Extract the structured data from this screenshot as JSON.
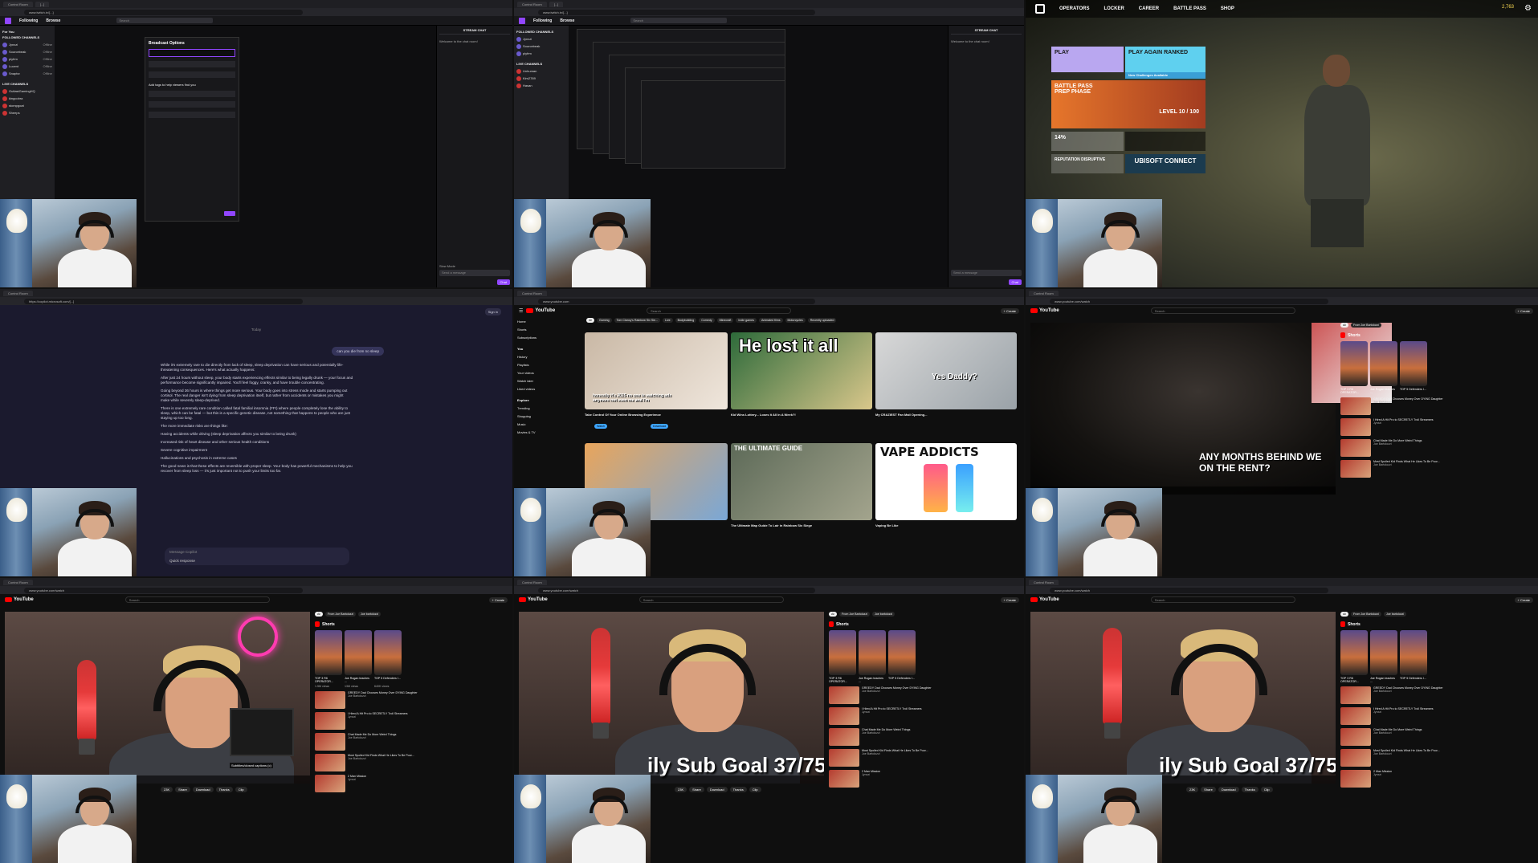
{
  "cells": {
    "c1": {
      "tabs": [
        "Control Room",
        "[...]"
      ],
      "url": "www.twitch.tv/[...]",
      "nav": [
        "For You",
        "Following",
        "Browse"
      ],
      "search_placeholder": "Search",
      "sidebar_header": "FOLLOWED CHANNELS",
      "live_header": "LIVE CHANNELS",
      "channels": [
        {
          "name": "Jynxzi",
          "status": "Offline"
        },
        {
          "name": "Sourcebeak",
          "status": "Offline"
        },
        {
          "name": "plyfrm",
          "status": "Offline"
        },
        {
          "name": "Lucent",
          "status": "Offline"
        },
        {
          "name": "Snaptrz",
          "status": "Offline"
        }
      ],
      "live_channels": [
        "OutlastGamingHQ",
        "kingcobra",
        "stompgoat",
        "Sheeps",
        "Unhuman",
        "Kim2789",
        "Hasan"
      ],
      "modal_title": "Broadcast Options",
      "modal_cta": "Add tags to help viewers find you",
      "chat_header": "STREAM CHAT",
      "chat_welcome": "Welcome to the chat room!",
      "chat_mode": "Slow Mode",
      "chat_placeholder": "Send a message",
      "chat_button": "Chat"
    },
    "c3": {
      "nav": [
        "OPERATORS",
        "LOCKER",
        "CAREER",
        "BATTLE PASS",
        "SHOP"
      ],
      "credits": "2,763",
      "play": "PLAY",
      "ranked": "PLAY AGAIN RANKED",
      "challenges": "New Challenges Available",
      "battlepass": "BATTLE PASS PREP PHASE",
      "level": "LEVEL 10 / 100",
      "reputation": "REPUTATION DISRUPTIVE",
      "connect": "UBISOFT CONNECT",
      "percent": "14%"
    },
    "c4": {
      "url": "https://copilot.microsoft.com/[...]",
      "signin": "Sign in",
      "today": "Today",
      "question": "can you die from no sleep",
      "answer": [
        "While it's extremely rare to die directly from lack of sleep, sleep deprivation can have serious and potentially life-threatening consequences. Here's what actually happens:",
        "After just 24 hours without sleep, your body starts experiencing effects similar to being legally drunk — your focus and performance become significantly impaired. You'll feel foggy, cranky, and have trouble concentrating.",
        "Going beyond 36 hours is where things get more serious. Your body goes into stress mode and starts pumping out cortisol. The real danger isn't dying from sleep deprivation itself, but rather from accidents or mistakes you might make while severely sleep-deprived.",
        "There is one extremely rare condition called fatal familial insomnia (FFI) where people completely lose the ability to sleep, which can be fatal — but this is a specific genetic disease, not something that happens to people who are just staying up too long.",
        "The more immediate risks are things like:",
        "Having accidents while driving (sleep deprivation affects you similar to being drunk)",
        "Increased risk of heart disease and other serious health conditions",
        "Severe cognitive impairment",
        "Hallucinations and psychosis in extreme cases",
        "The good news is that these effects are reversible with proper sleep. Your body has powerful mechanisms to help you recover from sleep loss — it's just important not to push your limits too far."
      ],
      "input_placeholder": "Message Copilot",
      "quick_response": "Quick response"
    },
    "c5": {
      "search": "Search",
      "create": "+ Create",
      "chips": [
        "All",
        "Gaming",
        "Tom Clancy's Rainbow Six Sie...",
        "Live",
        "Bodybuilding",
        "Comedy",
        "Minecraft",
        "Indie games",
        "Animated films",
        "Motorcycles",
        "Recently uploaded",
        "Watched",
        "New to you"
      ],
      "side": [
        "Home",
        "Shorts",
        "Subscriptions",
        "You",
        "History",
        "Playlists",
        "Your videos",
        "Watch later",
        "Liked videos",
        "Explore",
        "Trending",
        "Shopping",
        "Music",
        "Movies & TV"
      ],
      "videos": [
        {
          "title": "Take Control Of Your Online Browsing Experience",
          "overlay": "honestly it's 2025 no one is watching ads anymore not even me and I'm"
        },
        {
          "title": "Kid Wins Lottery... Loses It All In A Week?!",
          "overlay": "He lost it all"
        },
        {
          "title": "My CRAZIEST Fan Mail Opening...",
          "overlay": "Yes Daddy?"
        },
        {
          "title": "",
          "overlay": ""
        },
        {
          "title": "The Ultimate Map Guide To Lair in Rainbow Six Siege",
          "overlay": "THE ULTIMATE GUIDE"
        },
        {
          "title": "Vaping Be Like",
          "overlay": "VAPE ADDICTS"
        }
      ],
      "watch": "Watch",
      "download": "Download"
    },
    "c6": {
      "caption": "ANY MONTHS BEHIND WE ON THE RENT?",
      "subgoal": "ily Sub Goal 37/75"
    },
    "watch": {
      "chips": [
        "All",
        "From Joe Bartolozzi",
        "Joe bartolozzi"
      ],
      "shorts_header": "Shorts",
      "shorts": [
        {
          "title": "TOP 3 R6 OPERATOR...",
          "views": "1.5M views"
        },
        {
          "title": "Joe Rogan teaches ...",
          "views": "13M views"
        },
        {
          "title": "TOP 5 Defenders I...",
          "views": "640K views"
        }
      ],
      "recs": [
        {
          "title": "GREEDY Dad Chooses Money Over DYING Daughter",
          "channel": "Joe Bartolozzi"
        },
        {
          "title": "I Hired A Hit Pro to SECRETLY Troll Streamers",
          "channel": "Jynxzi"
        },
        {
          "title": "Chat Made Me Do More Weird Things",
          "channel": "Joe Bartolozzi"
        },
        {
          "title": "Most Spoiled Kid Finds What He Likes To Be Poor...",
          "channel": "Joe Bartolozzi"
        },
        {
          "title": "2 Man Mission",
          "channel": "Jynxzi"
        }
      ],
      "actions": [
        "23K",
        "Share",
        "Download",
        "Thanks",
        "Clip"
      ],
      "subgoal": "ily Sub Goal 37/75",
      "captions_label": "Subtitles/closed captions (c)"
    }
  }
}
